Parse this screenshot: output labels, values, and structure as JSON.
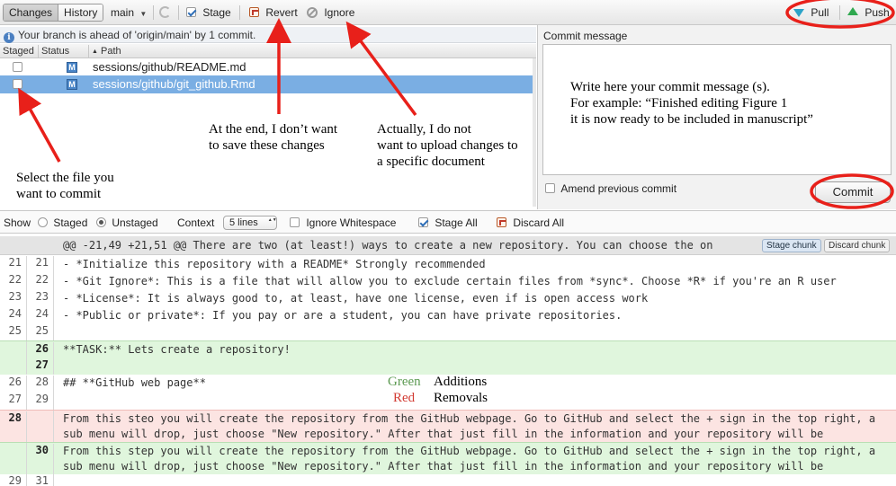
{
  "toolbar": {
    "changes_label": "Changes",
    "history_label": "History",
    "branch": "main",
    "stage_label": "Stage",
    "revert_label": "Revert",
    "ignore_label": "Ignore",
    "pull_label": "Pull",
    "push_label": "Push"
  },
  "status": {
    "message": "Your branch is ahead of 'origin/main' by 1 commit."
  },
  "file_list": {
    "columns": {
      "staged": "Staged",
      "status": "Status",
      "path": "Path"
    },
    "rows": [
      {
        "staged": false,
        "status": "M",
        "path": "sessions/github/README.md",
        "selected": false
      },
      {
        "staged": false,
        "status": "M",
        "path": "sessions/github/git_github.Rmd",
        "selected": true
      }
    ]
  },
  "commit": {
    "label": "Commit message",
    "placeholder_lines": [
      "Write here your commit message (s).",
      "For example: “Finished editing Figure 1",
      "it is now ready to be included in manuscript”"
    ],
    "amend_label": "Amend previous commit",
    "commit_button": "Commit"
  },
  "options": {
    "show_label": "Show",
    "staged_label": "Staged",
    "unstaged_label": "Unstaged",
    "show_selected": "unstaged",
    "context_label": "Context",
    "context_value": "5 lines",
    "ignore_whitespace_label": "Ignore Whitespace",
    "stage_all_label": "Stage All",
    "discard_all_label": "Discard All"
  },
  "diff": {
    "chunk_header": "@@ -21,49 +21,51 @@ There are two (at least!) ways to create a new repository. You can choose the on",
    "stage_chunk": "Stage chunk",
    "discard_chunk": "Discard chunk",
    "lines": [
      {
        "type": "ctx",
        "old": "21",
        "new": "21",
        "text": "- *Initialize this repository with a README* Strongly recommended"
      },
      {
        "type": "ctx",
        "old": "22",
        "new": "22",
        "text": "- *Git Ignore*: This is a file that will allow you to exclude certain files from *sync*. Choose *R* if you're an R user"
      },
      {
        "type": "ctx",
        "old": "23",
        "new": "23",
        "text": "- *License*: It is always good to, at least, have one license, even if is open access work"
      },
      {
        "type": "ctx",
        "old": "24",
        "new": "24",
        "text": "- *Public or private*: If you pay or are a student, you can have private repositories."
      },
      {
        "type": "ctx",
        "old": "25",
        "new": "25",
        "text": ""
      },
      {
        "type": "add",
        "old": "",
        "new": "26",
        "text": "**TASK:** Lets create a repository!"
      },
      {
        "type": "add",
        "old": "",
        "new": "27",
        "text": ""
      },
      {
        "type": "ctx",
        "old": "26",
        "new": "28",
        "text": "## **GitHub web page**"
      },
      {
        "type": "ctx",
        "old": "27",
        "new": "29",
        "text": ""
      },
      {
        "type": "del",
        "old": "28",
        "new": "",
        "text": "From this steo you will create the repository from the GitHub webpage. Go to GitHub and select the + sign in the top right, a sub menu will drop, just choose \"New repository.\" After that just fill in the information and your repository will be created."
      },
      {
        "type": "add",
        "old": "",
        "new": "30",
        "text": "From this step you will create the repository from the GitHub webpage. Go to GitHub and select the + sign in the top right, a sub menu will drop, just choose \"New repository.\" After that just fill in the information and your repository will be created."
      },
      {
        "type": "ctx",
        "old": "29",
        "new": "31",
        "text": ""
      }
    ]
  },
  "annotations": {
    "revert_note": [
      "At the end, I don’t want",
      "to save these changes"
    ],
    "ignore_note": [
      "Actually, I do not",
      "want to upload changes to",
      "a specific document"
    ],
    "select_note": [
      "Select the file you",
      "want to commit"
    ],
    "legend_green": "Green",
    "legend_green_desc": "Additions",
    "legend_red": "Red",
    "legend_red_desc": "Removals",
    "highlight_color": "#e8201a"
  }
}
